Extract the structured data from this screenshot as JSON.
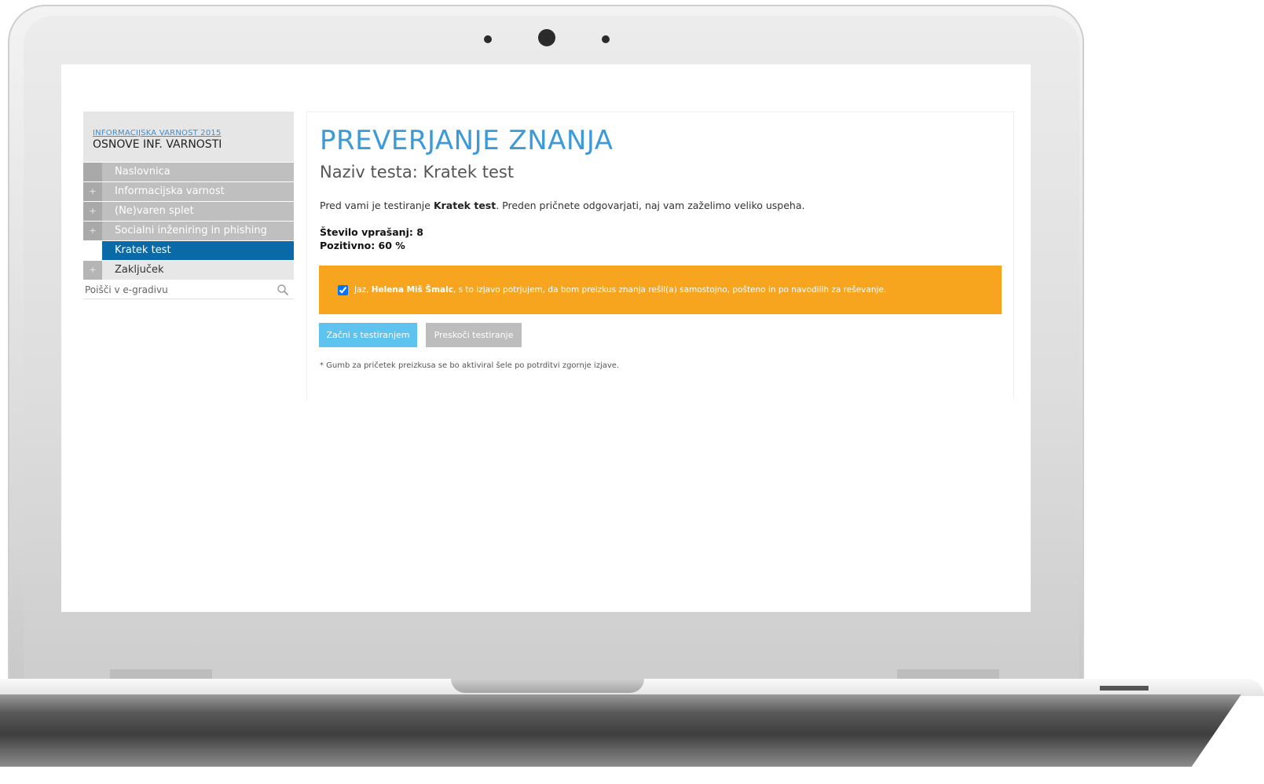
{
  "sidebar": {
    "course_link": "INFORMACIJSKA VARNOST 2015",
    "course_name": "OSNOVE INF. VARNOSTI",
    "items": [
      {
        "label": "Naslovnica",
        "has_plus": false
      },
      {
        "label": "Informacijska varnost",
        "has_plus": true
      },
      {
        "label": "(Ne)varen splet",
        "has_plus": true
      },
      {
        "label": "Socialni inženiring in phishing",
        "has_plus": true
      },
      {
        "label": "Kratek test",
        "has_plus": false,
        "active": true
      },
      {
        "label": "Zaključek",
        "has_plus": true
      }
    ],
    "plus_glyph": "+",
    "search_placeholder": "Poišči v e-gradivu",
    "search_icon": "search-icon"
  },
  "main": {
    "title": "PREVERJANJE ZNANJA",
    "subtitle": "Naziv testa: Kratek test",
    "intro_before": "Pred vami je testiranje ",
    "intro_bold": "Kratek test",
    "intro_after": ". Preden pričnete odgovarjati, naj vam zaželimo veliko uspeha.",
    "question_count": "Število vprašanj: 8",
    "pass_threshold": "Pozitivno: 60 %",
    "confirm": {
      "checked": true,
      "before": "Jaz, ",
      "name": "Helena Miš Šmalc",
      "after": ", s to izjavo potrjujem, da bom preizkus znanja rešil(a) samostojno, pošteno in po navodilih za reševanje."
    },
    "start_button": "Začni s testiranjem",
    "skip_button": "Preskoči testiranje",
    "note": "* Gumb za pričetek preizkusa se bo aktiviral šele po potrditvi zgornje izjave."
  },
  "colors": {
    "title": "#3c9ad9",
    "active_nav": "#0a6aa8",
    "confirm_bg": "#f7a51e",
    "start_button": "#5ec3ef",
    "skip_button": "#bdbdbd"
  }
}
